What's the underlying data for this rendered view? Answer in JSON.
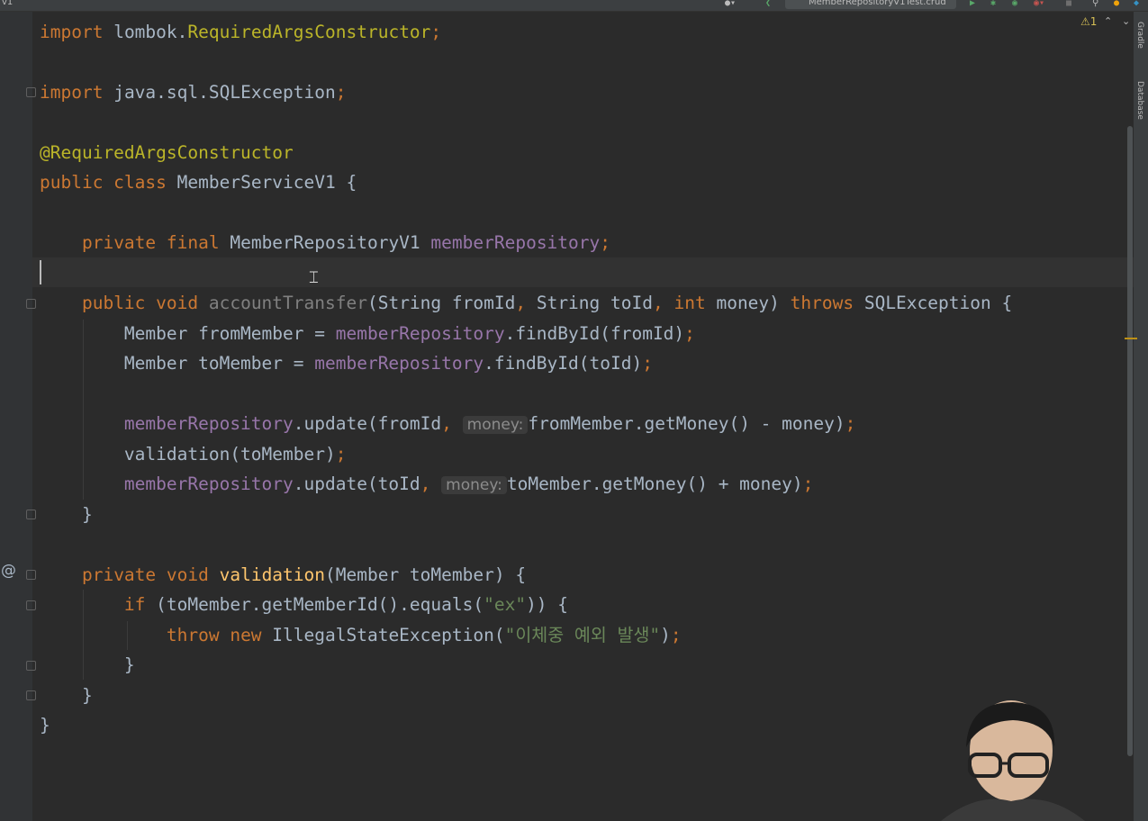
{
  "window": {
    "title_fragment": "v1"
  },
  "toolbar": {
    "run_config": "MemberRepositoryV1Test.crud"
  },
  "editor": {
    "inspections": {
      "warning_count": "1"
    },
    "right_tabs": [
      "Gradle",
      "Database"
    ],
    "code": {
      "l1": {
        "kw": "import",
        "pkg": "lombok.",
        "cls": "RequiredArgsConstructor",
        "semi": ";"
      },
      "l2": {
        "kw": "import",
        "rest": "java.sql.SQLException",
        "semi": ";"
      },
      "l3": {
        "ann": "@RequiredArgsConstructor"
      },
      "l4": {
        "kw": "public class",
        "name": "MemberServiceV1 {"
      },
      "l5": {
        "kw": "private final",
        "type": "MemberRepositoryV1",
        "field": "memberRepository",
        "semi": ";"
      },
      "l6": {
        "kw1": "public void",
        "method": "accountTransfer",
        "p1": "(String fromId",
        "c1": ",",
        "p2": " String toId",
        "c2": ",",
        "kw2": "int",
        "p3": " money) ",
        "kw3": "throws",
        "p4": " SQLException {"
      },
      "l7": {
        "a": "Member fromMember = ",
        "field": "memberRepository",
        "b": ".findById(fromId)",
        "semi": ";"
      },
      "l8": {
        "a": "Member toMember = ",
        "field": "memberRepository",
        "b": ".findById(toId)",
        "semi": ";"
      },
      "l9": {
        "field": "memberRepository",
        "a": ".update(fromId",
        "c": ",",
        "hint": "money:",
        "b": "fromMember.getMoney() - money)",
        "semi": ";"
      },
      "l10": {
        "a": "validation(toMember)",
        "semi": ";"
      },
      "l11": {
        "field": "memberRepository",
        "a": ".update(toId",
        "c": ",",
        "hint": "money:",
        "b": "toMember.getMoney() + money)",
        "semi": ";"
      },
      "l12": {
        "text": "}"
      },
      "l13": {
        "kw": "private void",
        "method": "validation",
        "rest": "(Member toMember) {"
      },
      "l14": {
        "kw": "if",
        "a": " (toMember.getMemberId().equals(",
        "str": "\"ex\"",
        "b": ")) {"
      },
      "l15": {
        "kw": "throw new",
        "a": " IllegalStateException(",
        "str": "\"이체중 예외 발생\"",
        "b": ")",
        "semi": ";"
      },
      "l16": {
        "text": "}"
      },
      "l17": {
        "text": "}"
      },
      "l18": {
        "text": "}"
      }
    },
    "gutter": {
      "override_marker": "@"
    }
  },
  "colors": {
    "background": "#2b2b2b",
    "keyword": "#cc7832",
    "annotation": "#bbb529",
    "field": "#9876aa",
    "method_decl": "#ffc66d",
    "string": "#6a8759",
    "default_text": "#a9b7c6"
  }
}
